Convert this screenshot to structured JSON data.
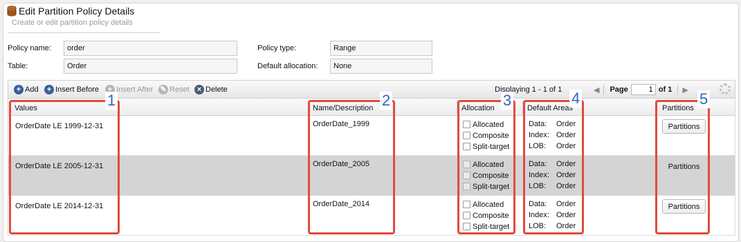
{
  "header": {
    "title": "Edit Partition Policy Details",
    "subtitle": "Create or edit partition policy details"
  },
  "form": {
    "policy_name_label": "Policy name:",
    "policy_name_value": "order",
    "table_label": "Table:",
    "table_value": "Order",
    "policy_type_label": "Policy type:",
    "policy_type_value": "Range",
    "default_allocation_label": "Default allocation:",
    "default_allocation_value": "None"
  },
  "toolbar": {
    "add": "Add",
    "insert_before": "Insert Before",
    "insert_after": "Insert After",
    "reset": "Reset",
    "delete": "Delete",
    "displaying": "Displaying 1 - 1 of 1",
    "page_label": "Page",
    "page_value": "1",
    "of_label": "of 1"
  },
  "columns": {
    "values": "Values",
    "name_description": "Name/Description",
    "allocation": "Allocation",
    "default_areas": "Default Areas",
    "partitions": "Partitions"
  },
  "rows": [
    {
      "values": "OrderDate LE  1999-12-31",
      "name": "OrderDate_1999",
      "alloc": [
        "Allocated",
        "Composite",
        "Split-target"
      ],
      "areas": [
        [
          "Data:",
          "Order"
        ],
        [
          "Index:",
          "Order"
        ],
        [
          "LOB:",
          "Order"
        ]
      ],
      "button": "Partitions"
    },
    {
      "values": "OrderDate LE  2005-12-31",
      "name": "OrderDate_2005",
      "alloc": [
        "Allocated",
        "Composite",
        "Split-target"
      ],
      "areas": [
        [
          "Data:",
          "Order"
        ],
        [
          "Index:",
          "Order"
        ],
        [
          "LOB:",
          "Order"
        ]
      ],
      "button": "Partitions"
    },
    {
      "values": "OrderDate LE  2014-12-31",
      "name": "OrderDate_2014",
      "alloc": [
        "Allocated",
        "Composite",
        "Split-target"
      ],
      "areas": [
        [
          "Data:",
          "Order"
        ],
        [
          "Index:",
          "Order"
        ],
        [
          "LOB:",
          "Order"
        ]
      ],
      "button": "Partitions"
    }
  ],
  "annotations": [
    "1",
    "2",
    "3",
    "4",
    "5"
  ],
  "colors": {
    "highlight": "#e24a3d",
    "annotation_number": "#2d66c0",
    "selected_row": "#d4d4d4"
  }
}
